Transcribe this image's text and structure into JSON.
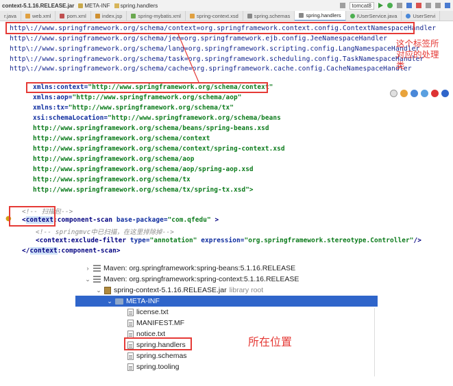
{
  "breadcrumb": {
    "jar": "context-5.1.16.RELEASE.jar",
    "folder": "META-INF",
    "file": "spring.handlers",
    "run_config": "tomcat8"
  },
  "tabs": [
    {
      "label": "r.java"
    },
    {
      "label": "web.xml"
    },
    {
      "label": "pom.xml"
    },
    {
      "label": "index.jsp"
    },
    {
      "label": "spring-mybatis.xml"
    },
    {
      "label": "spring-context.xsd"
    },
    {
      "label": "spring.schemas"
    },
    {
      "label": "spring.handlers",
      "active": true
    },
    {
      "label": "IUserService.java"
    },
    {
      "label": "UserServi"
    }
  ],
  "handlers_lines": [
    "http\\://www.springframework.org/schema/context=org.springframework.context.config.ContextNamespaceHandler",
    "http\\://www.springframework.org/schema/jee=org.springframework.ejb.config.JeeNamespaceHandler",
    "http\\://www.springframework.org/schema/lang=org.springframework.scripting.config.LangNamespaceHandler",
    "http\\://www.springframework.org/schema/task=org.springframework.scheduling.config.TaskNamespaceHandler",
    "http\\://www.springframework.org/schema/cache=org.springframework.cache.config.CacheNamespaceHandler"
  ],
  "annotation_top": [
    "这个标签所",
    "对应的处理",
    "类"
  ],
  "xml": {
    "xmlns_context_attr": "xmlns:context=",
    "xmlns_context_val": "\"http://www.springframework.org/schema/context\"",
    "xmlns_aop_attr": "xmlns:aop=",
    "xmlns_aop_val": "\"http://www.springframework.org/schema/aop\"",
    "xmlns_tx_attr": "xmlns:tx=",
    "xmlns_tx_val": "\"http://www.springframework.org/schema/tx\"",
    "xsi_attr": "xsi:schemaLocation=",
    "xsi_val": "\"http://www.springframework.org/schema/beans",
    "schema_urls": [
      "http://www.springframework.org/schema/beans/spring-beans.xsd",
      "http://www.springframework.org/schema/context",
      "http://www.springframework.org/schema/context/spring-context.xsd",
      "http://www.springframework.org/schema/aop",
      "http://www.springframework.org/schema/aop/spring-aop.xsd",
      "http://www.springframework.org/schema/tx",
      "http://www.springframework.org/schema/tx/spring-tx.xsd\">"
    ],
    "comment_scan": "<!-- 扫描包-->",
    "cs_open": "<",
    "cs_prefix": "context",
    "cs_name": ":component-scan",
    "cs_attr": " base-package=",
    "cs_val": "\"com.qfedu\"",
    "cs_end": " >",
    "comment_mvc": "<!-- springmvc中已扫描，在这里排除掉-->",
    "ef_tag": "<context:exclude-filter",
    "ef_type_attr": " type=",
    "ef_type_val": "\"annotation\"",
    "ef_expr_attr": " expression=",
    "ef_expr_val": "\"org.springframework.stereotype.Controller\"",
    "ef_close": "/>",
    "close_open": "</",
    "close_prefix": "context",
    "close_name": ":component-scan>"
  },
  "tree": {
    "beans_lib": "Maven: org.springframework:spring-beans:5.1.16.RELEASE",
    "context_lib": "Maven: org.springframework:spring-context:5.1.16.RELEASE",
    "jar": "spring-context-5.1.16.RELEASE.jar",
    "jar_note": "library root",
    "meta_inf": "META-INF",
    "files": [
      "license.txt",
      "MANIFEST.MF",
      "notice.txt",
      "spring.handlers",
      "spring.schemas",
      "spring.tooling"
    ]
  },
  "annotation_bottom": "所在位置",
  "colors": {
    "highlight_red": "#e53935",
    "selection_blue": "#2f65ca"
  }
}
